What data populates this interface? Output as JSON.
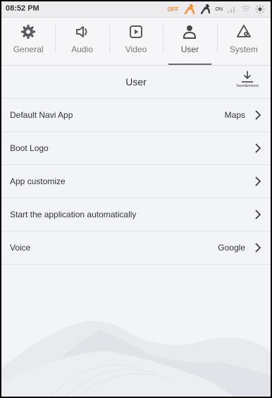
{
  "status_bar": {
    "time": "08:52 PM",
    "off_label": "OFF",
    "on_label": "ON",
    "colors": {
      "accent": "#ff8a2a"
    }
  },
  "tabs": [
    {
      "label": "General",
      "icon": "gear-icon",
      "active": false
    },
    {
      "label": "Audio",
      "icon": "speaker-icon",
      "active": false
    },
    {
      "label": "Video",
      "icon": "play-icon",
      "active": false
    },
    {
      "label": "User",
      "icon": "user-icon",
      "active": true
    },
    {
      "label": "System",
      "icon": "system-gear-icon",
      "active": false
    }
  ],
  "header": {
    "title": "User",
    "save_label": "Save&reboot"
  },
  "settings": [
    {
      "label": "Default Navi App",
      "value": "Maps"
    },
    {
      "label": "Boot Logo",
      "value": ""
    },
    {
      "label": "App customize",
      "value": ""
    },
    {
      "label": "Start the application automatically",
      "value": ""
    },
    {
      "label": "Voice",
      "value": "Google"
    }
  ]
}
